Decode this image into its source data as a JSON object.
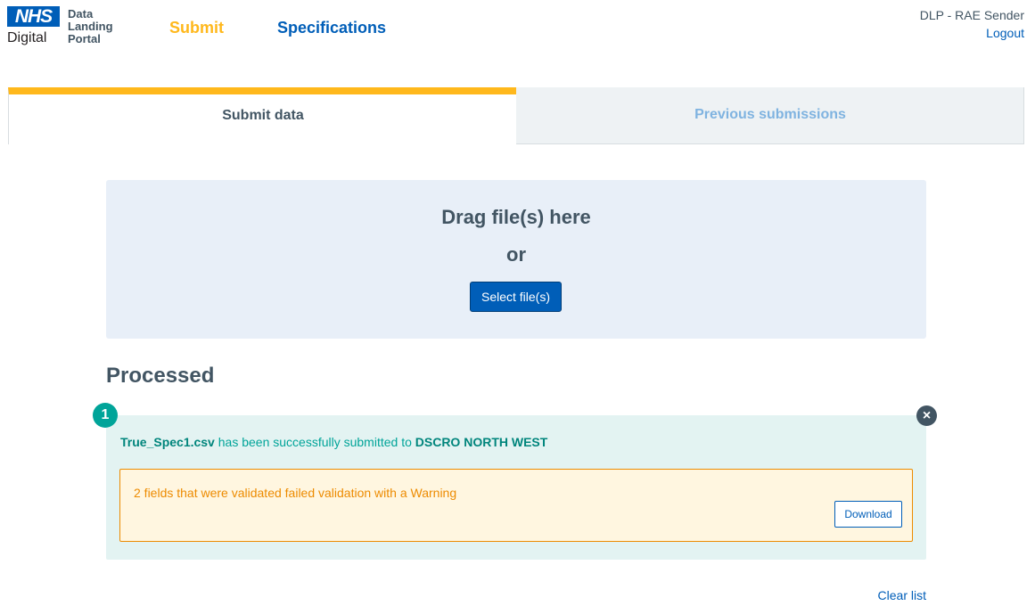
{
  "header": {
    "logo_text": "NHS",
    "logo_sub": "Digital",
    "portal_name_line1": "Data",
    "portal_name_line2": "Landing",
    "portal_name_line3": "Portal",
    "nav_submit": "Submit",
    "nav_specifications": "Specifications",
    "user_name": "DLP - RAE Sender",
    "logout": "Logout"
  },
  "tabs": {
    "submit_data": "Submit data",
    "previous_submissions": "Previous submissions"
  },
  "dropzone": {
    "title": "Drag file(s) here",
    "or": "or",
    "select_button": "Select file(s)"
  },
  "processed": {
    "title": "Processed",
    "count": "1",
    "file_name": "True_Spec1.csv",
    "message_middle": " has been successfully submitted to ",
    "destination": "DSCRO NORTH WEST",
    "warning_text": "2 fields that were validated failed validation with a Warning",
    "download_button": "Download",
    "close_icon": "×"
  },
  "footer": {
    "clear_list": "Clear list"
  },
  "colors": {
    "nhs_blue": "#005eb8",
    "warm_yellow": "#ffb81c",
    "aqua_green": "#00a499",
    "warning_orange": "#ed8b00",
    "dark_grey": "#425563"
  }
}
